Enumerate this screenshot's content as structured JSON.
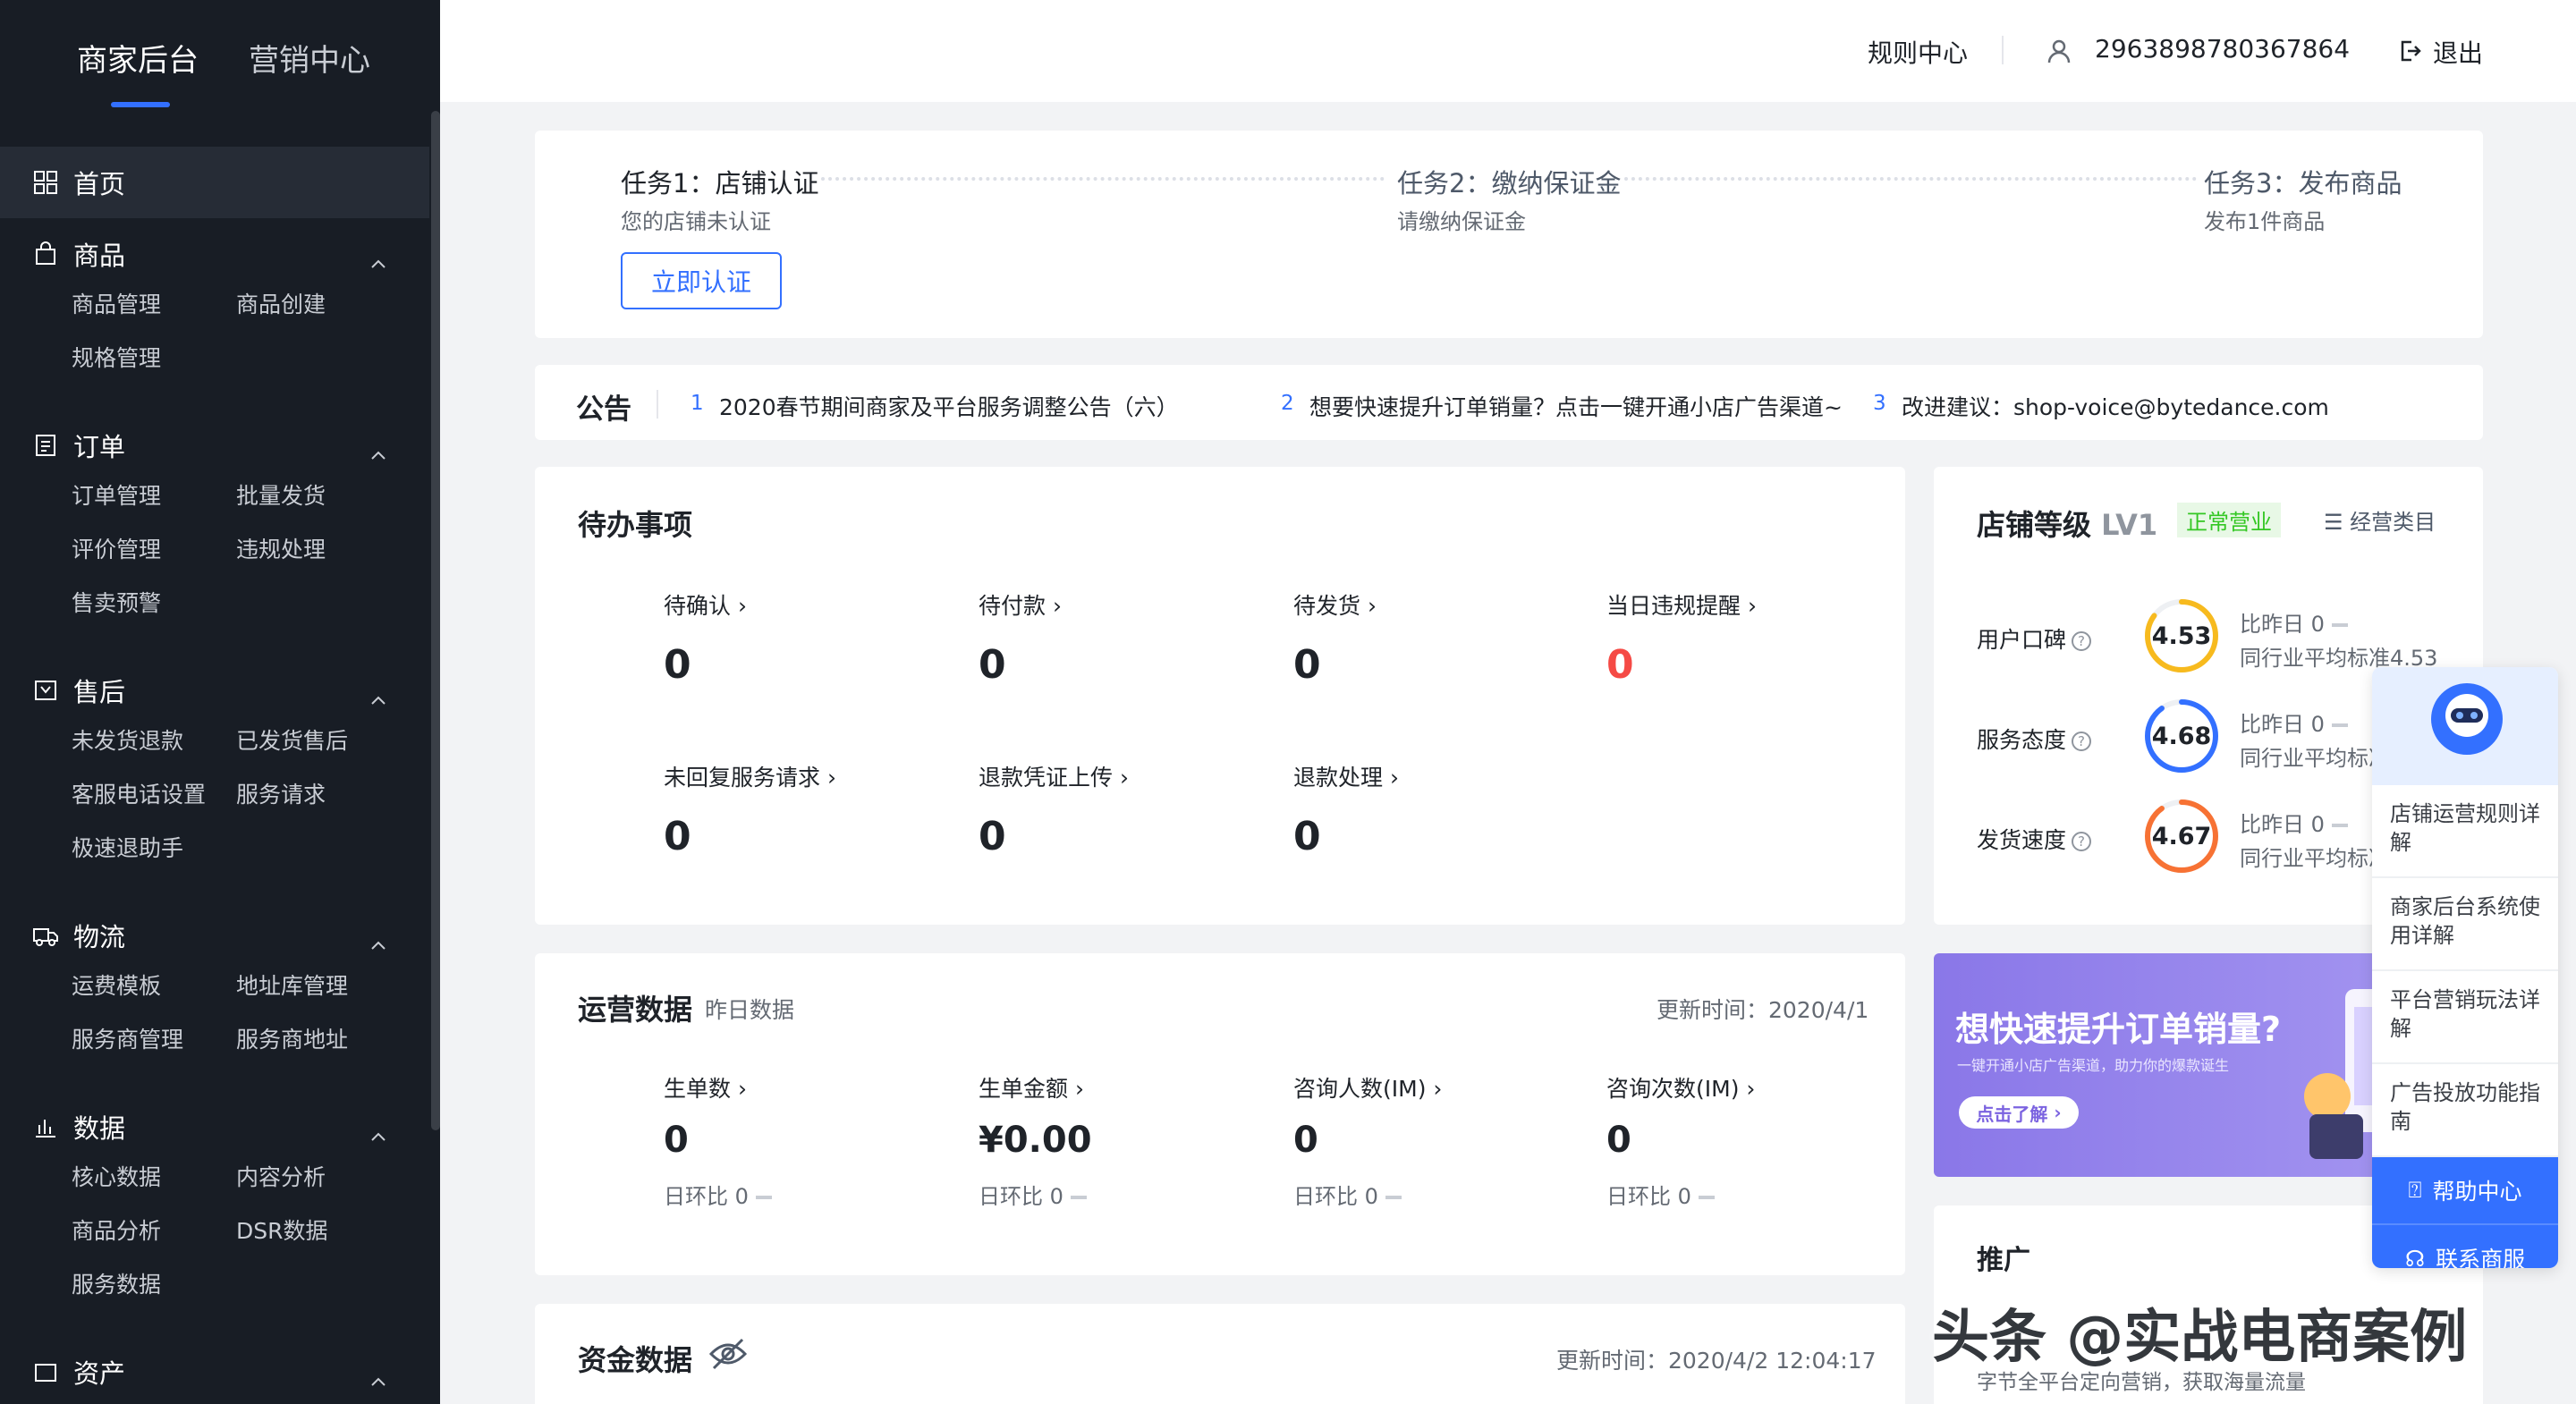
{
  "sidebar": {
    "tabs": [
      "商家后台",
      "营销中心"
    ],
    "home": "首页",
    "groups": [
      {
        "title": "商品",
        "items": [
          "商品管理",
          "商品创建",
          "规格管理"
        ]
      },
      {
        "title": "订单",
        "items": [
          "订单管理",
          "批量发货",
          "评价管理",
          "违规处理",
          "售卖预警"
        ]
      },
      {
        "title": "售后",
        "items": [
          "未发货退款",
          "已发货售后",
          "客服电话设置",
          "服务请求",
          "极速退助手"
        ]
      },
      {
        "title": "物流",
        "items": [
          "运费模板",
          "地址库管理",
          "服务商管理",
          "服务商地址"
        ]
      },
      {
        "title": "数据",
        "items": [
          "核心数据",
          "内容分析",
          "商品分析",
          "DSR数据",
          "服务数据"
        ]
      },
      {
        "title": "资产",
        "items": []
      }
    ]
  },
  "header": {
    "rules": "规则中心",
    "user_id": "2963898780367864",
    "logout": "退出"
  },
  "tasks": [
    {
      "title": "任务1：店铺认证",
      "sub": "您的店铺未认证"
    },
    {
      "title": "任务2：缴纳保证金",
      "sub": "请缴纳保证金"
    },
    {
      "title": "任务3：发布商品",
      "sub": "发布1件商品"
    }
  ],
  "task_button": "立即认证",
  "notice": {
    "label": "公告",
    "items": [
      {
        "num": "1",
        "text": "2020春节期间商家及平台服务调整公告（六）"
      },
      {
        "num": "2",
        "text": "想要快速提升订单销量？点击一键开通小店广告渠道~"
      },
      {
        "num": "3",
        "text": "改进建议：shop-voice@bytedance.com"
      }
    ]
  },
  "todo": {
    "title": "待办事项",
    "items": [
      {
        "label": "待确认",
        "value": "0"
      },
      {
        "label": "待付款",
        "value": "0"
      },
      {
        "label": "待发货",
        "value": "0"
      },
      {
        "label": "当日违规提醒",
        "value": "0"
      },
      {
        "label": "未回复服务请求",
        "value": "0"
      },
      {
        "label": "退款凭证上传",
        "value": "0"
      },
      {
        "label": "退款处理",
        "value": "0"
      }
    ]
  },
  "shop_level": {
    "title": "店铺等级",
    "level": "LV1",
    "status": "正常营业",
    "category": "经营类目",
    "metrics": [
      {
        "label": "用户口碑",
        "score": "4.53",
        "ring_fraction": 0.85,
        "color": "#f7ba1e",
        "cmp": "比昨日 0",
        "avg": "同行业平均标准4.53"
      },
      {
        "label": "服务态度",
        "score": "4.68",
        "ring_fraction": 0.9,
        "color": "#3370ff",
        "cmp": "比昨日 0",
        "avg": "同行业平均标准"
      },
      {
        "label": "发货速度",
        "score": "4.67",
        "ring_fraction": 0.9,
        "color": "#f77234",
        "cmp": "比昨日 0",
        "avg": "同行业平均标准"
      }
    ]
  },
  "ops": {
    "title": "运营数据",
    "subtitle": "昨日数据",
    "updated": "更新时间：2020/4/1",
    "items": [
      {
        "label": "生单数",
        "value": "0",
        "cmp": "日环比 0"
      },
      {
        "label": "生单金额",
        "value": "¥0.00",
        "cmp": "日环比 0"
      },
      {
        "label": "咨询人数(IM)",
        "value": "0",
        "cmp": "日环比 0"
      },
      {
        "label": "咨询次数(IM)",
        "value": "0",
        "cmp": "日环比 0"
      }
    ]
  },
  "banner": {
    "title": "想快速提升订单销量?",
    "sub": "一键开通小店广告渠道，助力你的爆款诞生",
    "button": "点击了解"
  },
  "promo": {
    "title": "推广",
    "text": "字节全平台定向营销，获取海量流量"
  },
  "funds": {
    "title": "资金数据",
    "updated": "更新时间：2020/4/2 12:04:17"
  },
  "help": {
    "items": [
      "店铺运营规则详解",
      "商家后台系统使用详解",
      "平台营销玩法详解",
      "广告投放功能指南"
    ],
    "help_center": "帮助中心",
    "contact": "联系商服"
  },
  "watermark": "头条 @实战电商案例"
}
